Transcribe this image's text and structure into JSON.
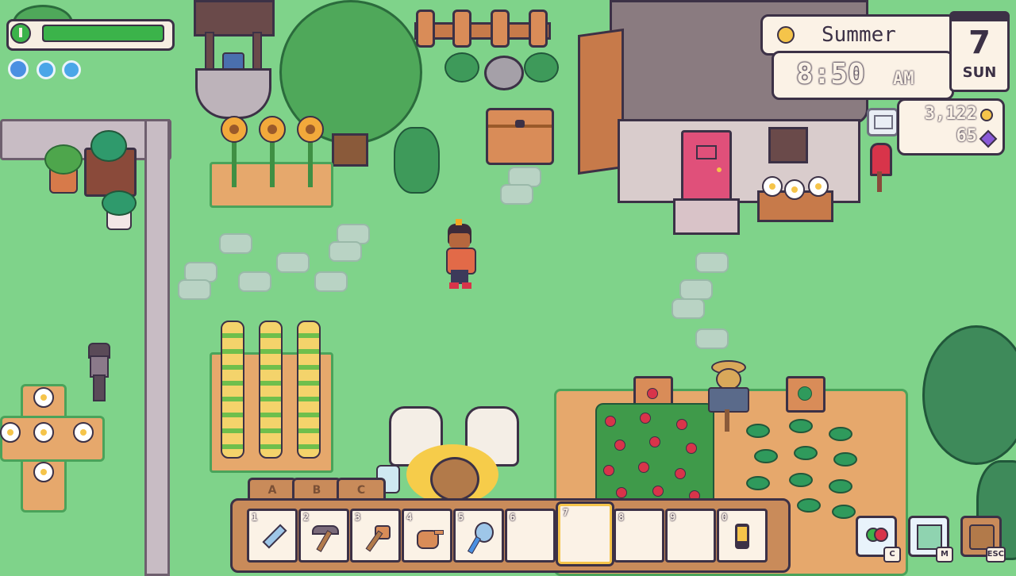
{
  "hud": {
    "energy_icon": "power-icon",
    "energy_fraction": 1.0,
    "health_orbs": 3,
    "season": "Summer",
    "time": "8:50",
    "ampm": "AM",
    "day_number": "7",
    "day_name": "SUN",
    "gold": "3,122",
    "gems": "65",
    "mail_icon": "mail-icon",
    "sun_icon": "sun-icon"
  },
  "hotbar": {
    "tabs": [
      "A",
      "B",
      "C"
    ],
    "slots": [
      {
        "num": "1",
        "item": "sword-icon"
      },
      {
        "num": "2",
        "item": "pickaxe-icon"
      },
      {
        "num": "3",
        "item": "axe-icon"
      },
      {
        "num": "4",
        "item": "watering-can-icon"
      },
      {
        "num": "5",
        "item": "net-icon"
      },
      {
        "num": "6",
        "item": ""
      },
      {
        "num": "7",
        "item": ""
      },
      {
        "num": "8",
        "item": ""
      },
      {
        "num": "9",
        "item": ""
      },
      {
        "num": "0",
        "item": "phone-icon"
      }
    ],
    "selected_slot": "7"
  },
  "menu_buttons": [
    {
      "name": "collection-button",
      "key": "C",
      "icon": "heart-icon"
    },
    {
      "name": "map-button",
      "key": "M",
      "icon": "map-icon"
    },
    {
      "name": "menu-button",
      "key": "ESC",
      "icon": "menu-icon"
    }
  ],
  "colors": {
    "grass": "#7fd38a",
    "energy": "#3bb34a",
    "outline": "#3c3146",
    "panel": "#fbf2e6",
    "door": "#e0507a"
  }
}
